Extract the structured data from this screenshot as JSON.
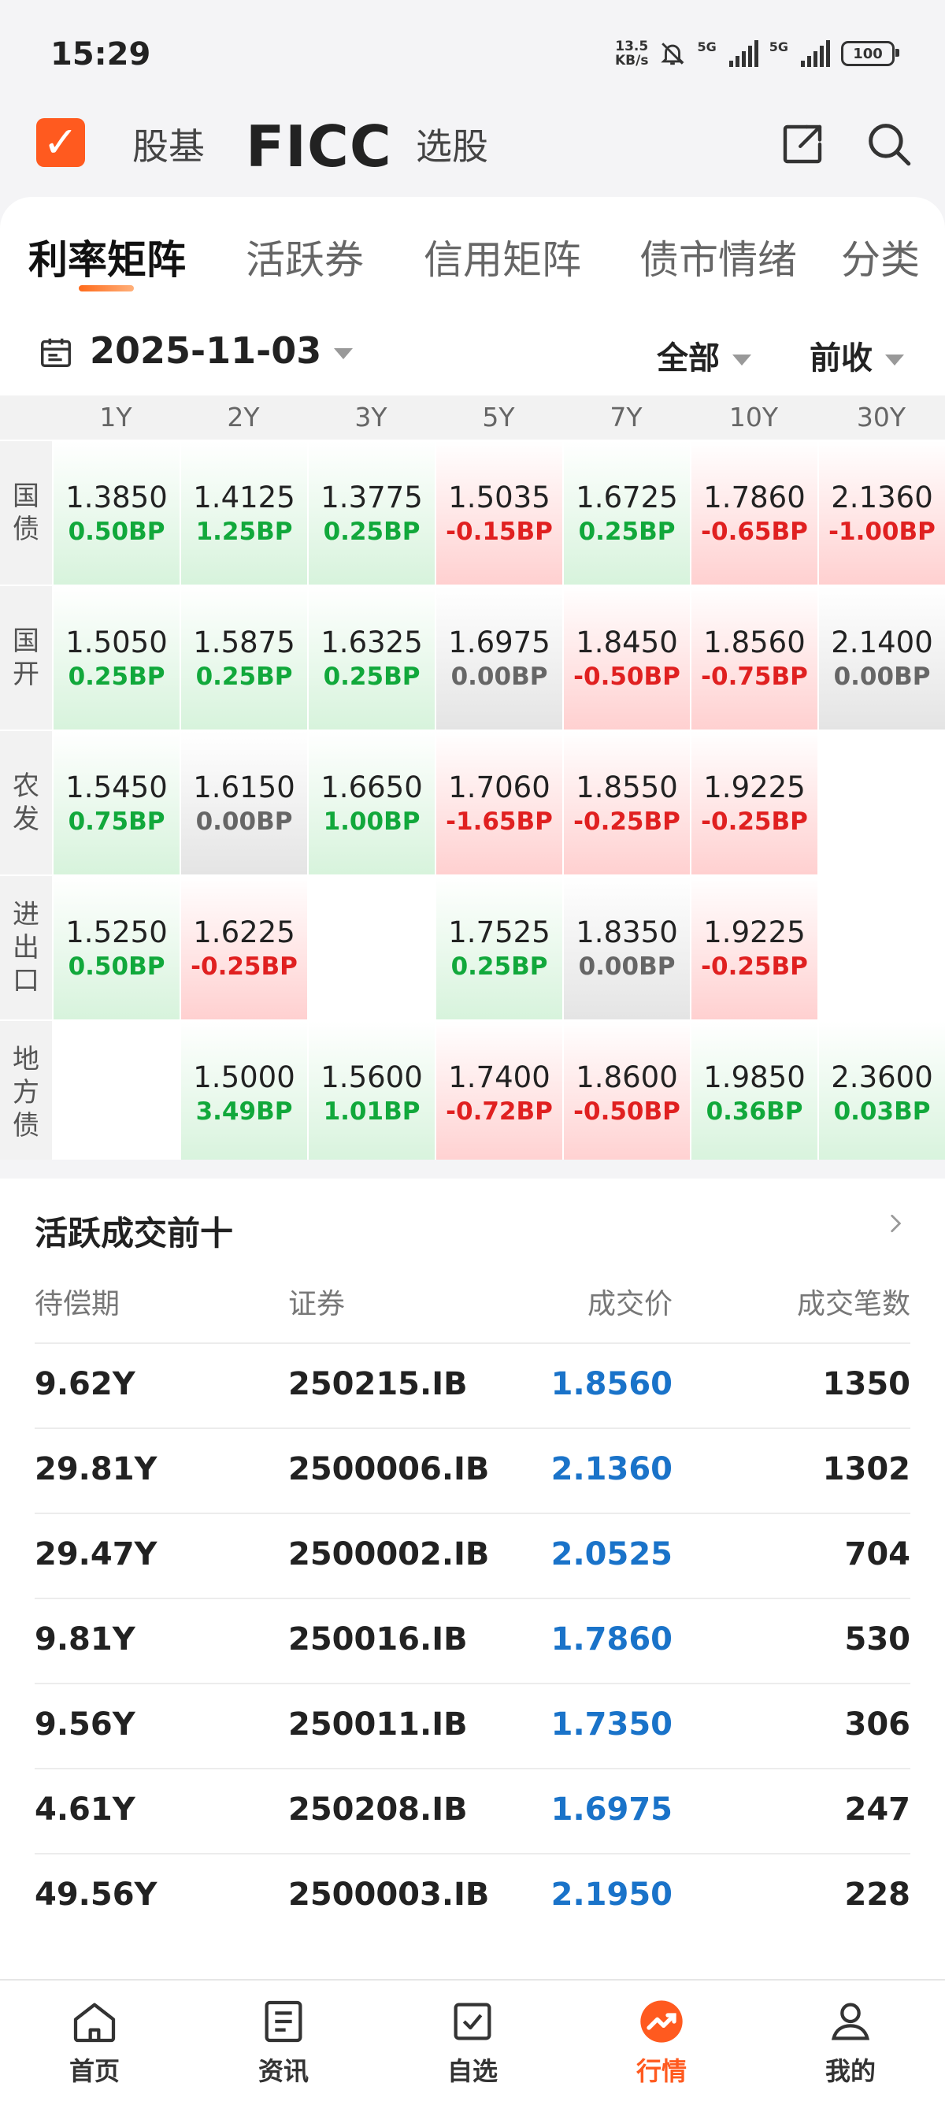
{
  "status": {
    "time": "15:29",
    "net_speed_top": "13.5",
    "net_speed_bottom": "KB/s",
    "sim1": "5G",
    "sim2": "5G",
    "battery": "100"
  },
  "header": {
    "tabs": [
      {
        "label": "股基"
      },
      {
        "label": "FICC"
      },
      {
        "label": "选股"
      }
    ]
  },
  "subtabs": [
    "利率矩阵",
    "活跃券",
    "信用矩阵",
    "债市情绪",
    "分类"
  ],
  "filters": {
    "date": "2025-11-03",
    "scope": "全部",
    "compare": "前收"
  },
  "matrix": {
    "columns": [
      "1Y",
      "2Y",
      "3Y",
      "5Y",
      "7Y",
      "10Y",
      "30Y"
    ],
    "rows": [
      {
        "label": [
          "国",
          "债"
        ],
        "cells": [
          {
            "yield": "1.3850",
            "bp": "0.50BP",
            "dir": "up"
          },
          {
            "yield": "1.4125",
            "bp": "1.25BP",
            "dir": "up"
          },
          {
            "yield": "1.3775",
            "bp": "0.25BP",
            "dir": "up"
          },
          {
            "yield": "1.5035",
            "bp": "-0.15BP",
            "dir": "down"
          },
          {
            "yield": "1.6725",
            "bp": "0.25BP",
            "dir": "up"
          },
          {
            "yield": "1.7860",
            "bp": "-0.65BP",
            "dir": "down"
          },
          {
            "yield": "2.1360",
            "bp": "-1.00BP",
            "dir": "down"
          }
        ]
      },
      {
        "label": [
          "国",
          "开"
        ],
        "cells": [
          {
            "yield": "1.5050",
            "bp": "0.25BP",
            "dir": "up"
          },
          {
            "yield": "1.5875",
            "bp": "0.25BP",
            "dir": "up"
          },
          {
            "yield": "1.6325",
            "bp": "0.25BP",
            "dir": "up"
          },
          {
            "yield": "1.6975",
            "bp": "0.00BP",
            "dir": "flat"
          },
          {
            "yield": "1.8450",
            "bp": "-0.50BP",
            "dir": "down"
          },
          {
            "yield": "1.8560",
            "bp": "-0.75BP",
            "dir": "down"
          },
          {
            "yield": "2.1400",
            "bp": "0.00BP",
            "dir": "flat"
          }
        ]
      },
      {
        "label": [
          "农",
          "发"
        ],
        "cells": [
          {
            "yield": "1.5450",
            "bp": "0.75BP",
            "dir": "up"
          },
          {
            "yield": "1.6150",
            "bp": "0.00BP",
            "dir": "flat"
          },
          {
            "yield": "1.6650",
            "bp": "1.00BP",
            "dir": "up"
          },
          {
            "yield": "1.7060",
            "bp": "-1.65BP",
            "dir": "down"
          },
          {
            "yield": "1.8550",
            "bp": "-0.25BP",
            "dir": "down"
          },
          {
            "yield": "1.9225",
            "bp": "-0.25BP",
            "dir": "down"
          },
          {
            "yield": "",
            "bp": "",
            "dir": "empty"
          }
        ]
      },
      {
        "label": [
          "进",
          "出",
          "口"
        ],
        "cells": [
          {
            "yield": "1.5250",
            "bp": "0.50BP",
            "dir": "up"
          },
          {
            "yield": "1.6225",
            "bp": "-0.25BP",
            "dir": "down"
          },
          {
            "yield": "",
            "bp": "",
            "dir": "empty"
          },
          {
            "yield": "1.7525",
            "bp": "0.25BP",
            "dir": "up"
          },
          {
            "yield": "1.8350",
            "bp": "0.00BP",
            "dir": "flat"
          },
          {
            "yield": "1.9225",
            "bp": "-0.25BP",
            "dir": "down"
          },
          {
            "yield": "",
            "bp": "",
            "dir": "empty"
          }
        ]
      },
      {
        "label": [
          "地",
          "方",
          "债"
        ],
        "cells": [
          {
            "yield": "",
            "bp": "",
            "dir": "empty"
          },
          {
            "yield": "1.5000",
            "bp": "3.49BP",
            "dir": "up"
          },
          {
            "yield": "1.5600",
            "bp": "1.01BP",
            "dir": "up"
          },
          {
            "yield": "1.7400",
            "bp": "-0.72BP",
            "dir": "down"
          },
          {
            "yield": "1.8600",
            "bp": "-0.50BP",
            "dir": "down"
          },
          {
            "yield": "1.9850",
            "bp": "0.36BP",
            "dir": "up"
          },
          {
            "yield": "2.3600",
            "bp": "0.03BP",
            "dir": "up"
          }
        ]
      }
    ]
  },
  "top_trades": {
    "title": "活跃成交前十",
    "headers": [
      "待偿期",
      "证券",
      "成交价",
      "成交笔数"
    ],
    "rows": [
      {
        "term": "9.62Y",
        "security": "250215.IB",
        "price": "1.8560",
        "count": "1350"
      },
      {
        "term": "29.81Y",
        "security": "2500006.IB",
        "price": "2.1360",
        "count": "1302"
      },
      {
        "term": "29.47Y",
        "security": "2500002.IB",
        "price": "2.0525",
        "count": "704"
      },
      {
        "term": "9.81Y",
        "security": "250016.IB",
        "price": "1.7860",
        "count": "530"
      },
      {
        "term": "9.56Y",
        "security": "250011.IB",
        "price": "1.7350",
        "count": "306"
      },
      {
        "term": "4.61Y",
        "security": "250208.IB",
        "price": "1.6975",
        "count": "247"
      },
      {
        "term": "49.56Y",
        "security": "2500003.IB",
        "price": "2.1950",
        "count": "228"
      }
    ]
  },
  "nav": [
    {
      "label": "首页",
      "icon": "home-icon"
    },
    {
      "label": "资讯",
      "icon": "news-icon"
    },
    {
      "label": "自选",
      "icon": "watchlist-icon"
    },
    {
      "label": "行情",
      "icon": "market-icon",
      "active": true
    },
    {
      "label": "我的",
      "icon": "profile-icon"
    }
  ],
  "colors": {
    "accent": "#ff5a1f",
    "up": "#11a83b",
    "down": "#e02020",
    "price_blue": "#1a73c9"
  }
}
